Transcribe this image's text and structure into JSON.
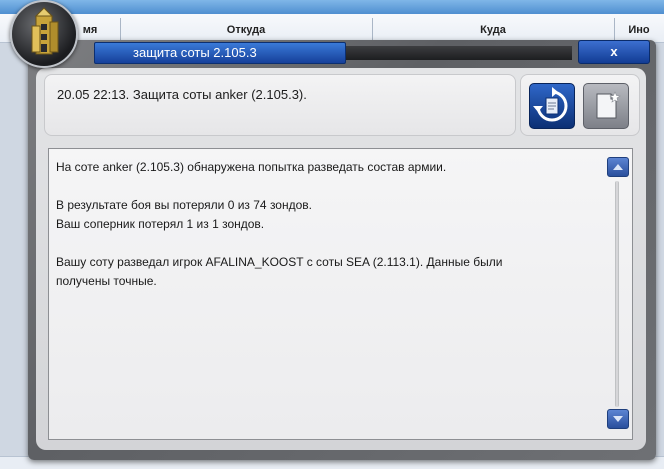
{
  "background_table": {
    "headers": [
      "мя",
      "Откуда",
      "Куда",
      "Ино"
    ]
  },
  "dialog": {
    "title": "защита соты 2.105.3",
    "close_label": "x",
    "summary": "20.05 22:13. Защита соты anker (2.105.3).",
    "message_lines": [
      "На соте anker (2.105.3) обнаружена попытка разведать состав армии.",
      "",
      "В результате боя вы потеряли 0 из 74 зондов.",
      "Ваш соперник потерял 1 из 1 зондов.",
      "",
      "Вашу соту разведал игрок AFALINA_KOOST с соты SEA (2.113.1). Данные были",
      "получены точные."
    ]
  },
  "icons": {
    "logo": "tower-logo-icon",
    "refresh": "refresh-document-icon",
    "note": "new-note-icon",
    "scroll_up": "arrow-up-icon",
    "scroll_down": "arrow-down-icon"
  },
  "colors": {
    "title_bar": "#1f4fae",
    "frame": "#6b6d71",
    "panel": "#e3e4e6"
  }
}
